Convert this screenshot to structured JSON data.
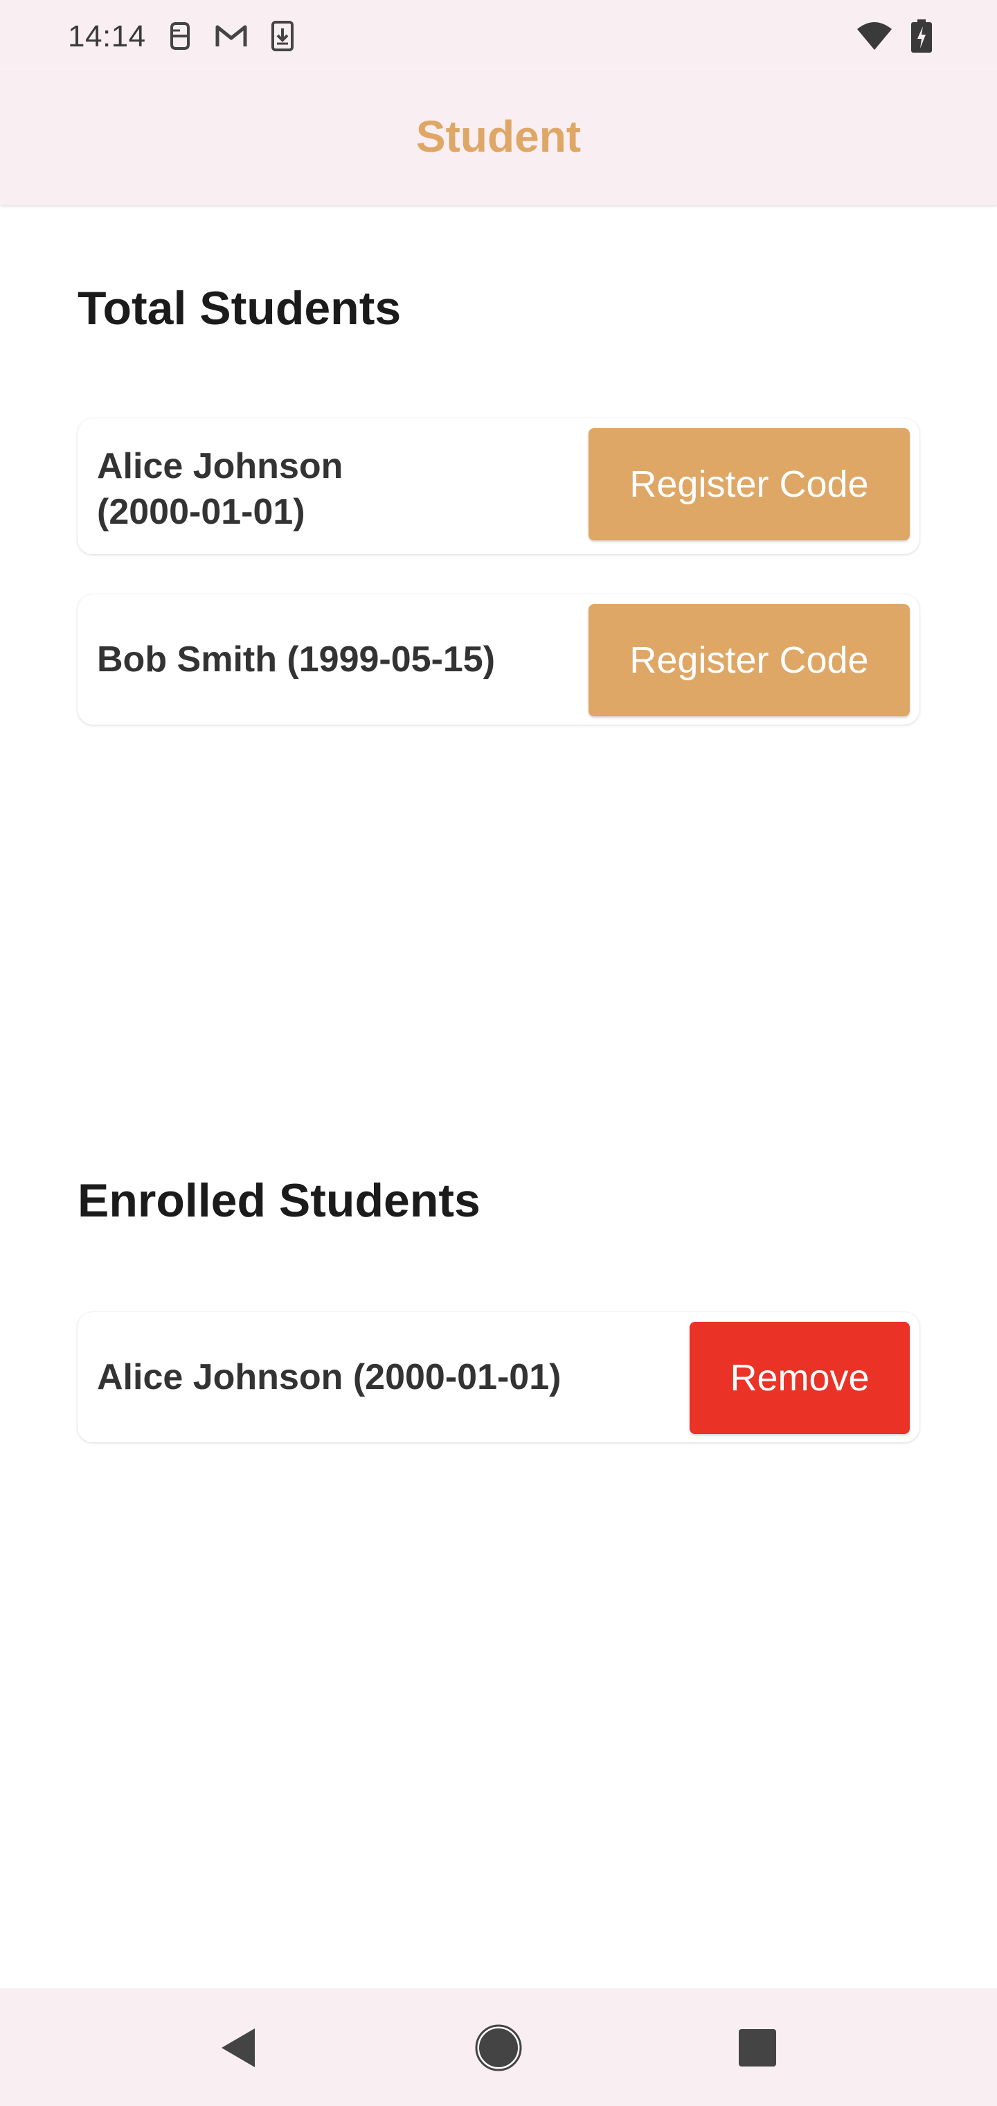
{
  "status_bar": {
    "time": "14:14",
    "left_icons": [
      "notification-bug-icon",
      "gmail-icon",
      "download-icon"
    ],
    "right_icons": [
      "wifi-icon",
      "battery-charging-icon"
    ]
  },
  "app_bar": {
    "title": "Student"
  },
  "total_students": {
    "title": "Total Students",
    "items": [
      {
        "line1": "Alice Johnson",
        "line2": "(2000-01-01)",
        "button": "Register Code"
      },
      {
        "line1": "Bob Smith (1999-05-15)",
        "button": "Register Code"
      }
    ]
  },
  "enrolled_students": {
    "title": "Enrolled Students",
    "items": [
      {
        "line1": "Alice Johnson (2000-01-01)",
        "button": "Remove"
      }
    ]
  },
  "nav_bar": {
    "icons": [
      "back-icon",
      "home-icon",
      "recents-icon"
    ]
  },
  "colors": {
    "accent": "#dea766",
    "remove": "#ea3226",
    "bar_background": "#f9eef1"
  }
}
